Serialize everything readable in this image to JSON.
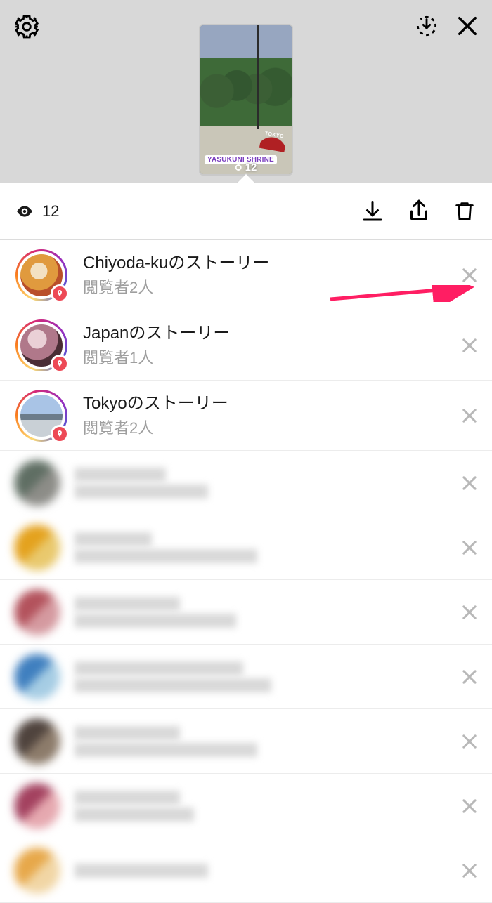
{
  "thumbnail": {
    "location_tag": "YASUKUNI SHRINE",
    "fan_text": "TOKYO",
    "view_count": "12"
  },
  "action_bar": {
    "view_count": "12"
  },
  "stories": [
    {
      "title": "Chiyoda-kuのストーリー",
      "subtitle": "閲覧者2人",
      "avatar_class": "avatar-chiyoda"
    },
    {
      "title": "Japanのストーリー",
      "subtitle": "閲覧者1人",
      "avatar_class": "avatar-japan"
    },
    {
      "title": "Tokyoのストーリー",
      "subtitle": "閲覧者2人",
      "avatar_class": "avatar-tokyo"
    }
  ],
  "blurred_viewers_count": 7
}
